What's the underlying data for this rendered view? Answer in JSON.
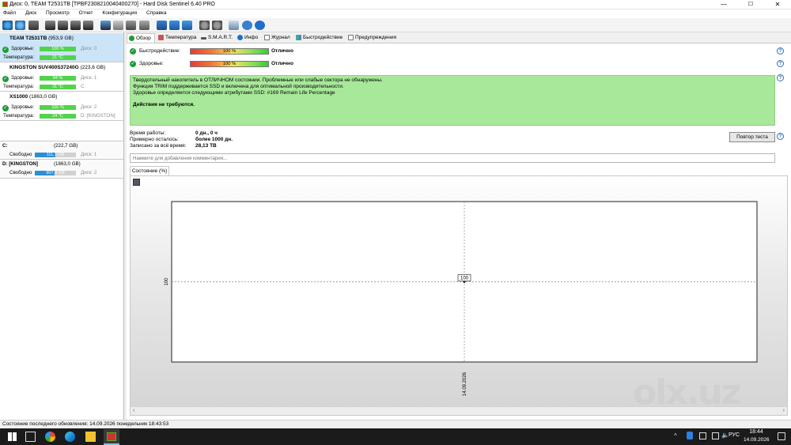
{
  "window": {
    "title": "Диск: 0, TEAM T2531TB [TPBF2308210040400270] - Hard Disk Sentinel 6.40 PRO",
    "minimize": "—",
    "maximize": "☐",
    "close": "✕"
  },
  "menu": [
    "Файл",
    "Диск",
    "Просмотр",
    "Отчет",
    "Конфигурация",
    "Справка"
  ],
  "disks": [
    {
      "name": "TEAM T2531TB",
      "size": "(953,9 GB)",
      "health_label": "Здоровье:",
      "health": "100 %",
      "health_pct": 100,
      "disk_ref": "Диск: 0",
      "temp_label": "Температура:",
      "temp": "21 °C",
      "drive_letter": ""
    },
    {
      "name": "KINGSTON SUV400S37240G",
      "size": "(223,6 GB)",
      "health_label": "Здоровье:",
      "health": "94 %",
      "health_pct": 94,
      "disk_ref": "Диск: 1",
      "temp_label": "Температура:",
      "temp": "31 °C",
      "drive_letter": "C:"
    },
    {
      "name": "XS1000",
      "size": "(1863,0 GB)",
      "health_label": "Здоровье:",
      "health": "100 %",
      "health_pct": 100,
      "disk_ref": "Диск: 2",
      "temp_label": "Температура:",
      "temp": "24 °C",
      "drive_letter": "D: [KINGSTON]"
    }
  ],
  "volumes": [
    {
      "name": "C:",
      "size": "(222,7 GB)",
      "free_label": "Свободно",
      "free": "111,7 GB",
      "free_pct": 50,
      "disk_ref": "Диск: 1"
    },
    {
      "name": "D: [KINGSTON]",
      "size": "(1863,0 GB)",
      "free_label": "Свободно",
      "free": "907,9 GB",
      "free_pct": 49,
      "disk_ref": "Диск: 2"
    }
  ],
  "tabs": [
    "Обзор",
    "Температура",
    "S.M.A.R.T.",
    "Инфо",
    "Журнал",
    "Быстродействие",
    "Предупреждения"
  ],
  "overview": {
    "performance_label": "Быстродействие:",
    "performance_value": "100 %",
    "performance_status": "Отлично",
    "health_label": "Здоровье:",
    "health_value": "100 %",
    "health_status": "Отлично",
    "message_lines": [
      "Твердотельный накопитель в ОТЛИЧНОМ состоянии. Проблемные или слабые сектора не обнаружены.",
      "Функция TRIM поддерживается SSD и включена для оптимальной производительности.",
      "Здоровье определяется следующими атрибутами SSD: #169 Remain Life Percentage"
    ],
    "message_action": "Действия не требуются.",
    "uptime_label": "Время работы:",
    "uptime_value": "0 дн., 0 ч",
    "remaining_label": "Примерно осталось:",
    "remaining_value": "более 1000 дн.",
    "written_label": "Записано за всё время:",
    "written_value": "28,13 TB",
    "retest_button": "Повтор теста",
    "comment_placeholder": "Нажмите для добавления комментария...",
    "help": "?"
  },
  "chart_data": {
    "type": "line",
    "title": "Состояние (%)",
    "x": [
      "14.09.2026"
    ],
    "series": [
      {
        "values": [
          100
        ]
      }
    ],
    "ylabel": "",
    "yticks": [
      "100"
    ],
    "point_label": "100",
    "grid": true
  },
  "statusbar": {
    "text": "Состояние последнего обновления: 14.09.2026 понедельник 18:43:53"
  },
  "taskbar": {
    "time": "18:44",
    "date": "14.09.2026",
    "lang": "РУС"
  },
  "watermark": "olx.uz",
  "colors": {
    "ok": "#1f9a3a",
    "health_bar": "#52d34c",
    "free_bar": "#2d8fd4",
    "message_bg": "#a8e89a"
  }
}
